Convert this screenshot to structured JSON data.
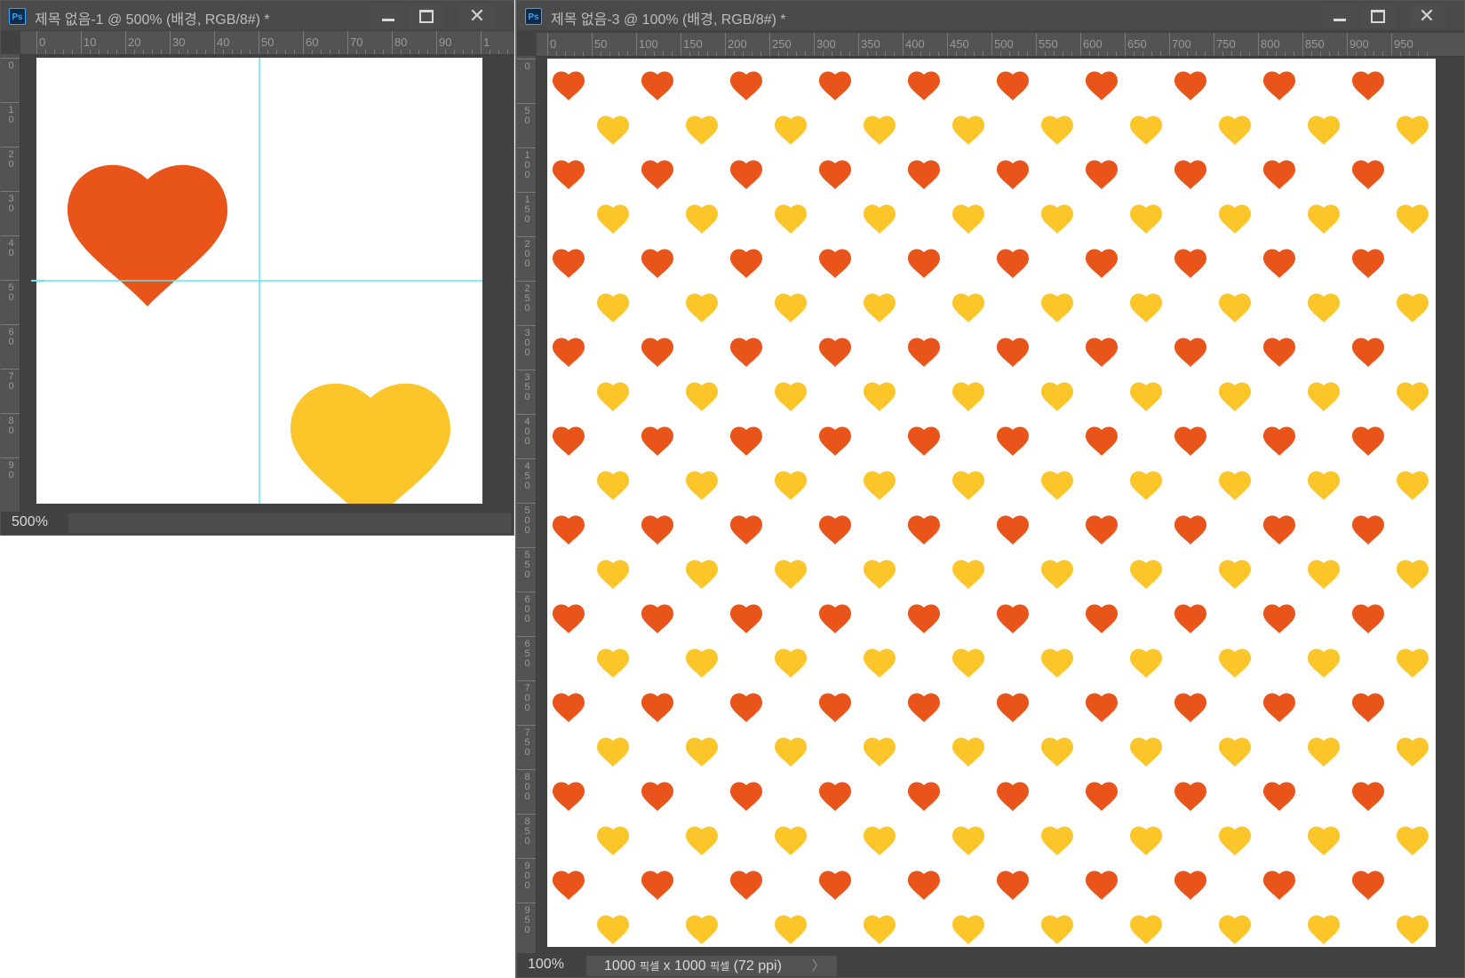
{
  "windows": [
    {
      "title": "제목 없음-1 @ 500% (배경, RGB/8#) *",
      "zoom": "500%",
      "ruler_top": [
        "0",
        "10",
        "20",
        "30",
        "40",
        "50",
        "60",
        "70",
        "80",
        "90",
        "1"
      ],
      "ruler_left": [
        "0",
        "10",
        "20",
        "30",
        "40",
        "50",
        "60",
        "70",
        "80",
        "90"
      ],
      "hearts": [
        {
          "color": "#e8541a"
        },
        {
          "color": "#fcc62b"
        }
      ]
    },
    {
      "title": "제목 없음-3 @ 100% (배경, RGB/8#) *",
      "zoom": "100%",
      "size_value_w": "1000",
      "size_unit": "픽셀",
      "size_x": "x",
      "size_value_h": "1000",
      "size_ppi": "(72 ppi)",
      "ruler_top": [
        "0",
        "50",
        "100",
        "150",
        "200",
        "250",
        "300",
        "350",
        "400",
        "450",
        "500",
        "550",
        "600",
        "650",
        "700",
        "750",
        "800",
        "850",
        "900",
        "950"
      ],
      "ruler_left": [
        "0",
        "50",
        "100",
        "150",
        "200",
        "250",
        "300",
        "350",
        "400",
        "450",
        "500",
        "550",
        "600",
        "650",
        "700",
        "750",
        "800",
        "850",
        "900",
        "950"
      ]
    }
  ],
  "icons": {
    "app": "Ps",
    "minimize": "minimize-icon",
    "maximize": "maximize-icon",
    "close": "✕",
    "chevron": "〉"
  },
  "colors": {
    "orange_heart": "#e8541a",
    "yellow_heart": "#fcc62b",
    "guide": "#5fe8f0"
  }
}
